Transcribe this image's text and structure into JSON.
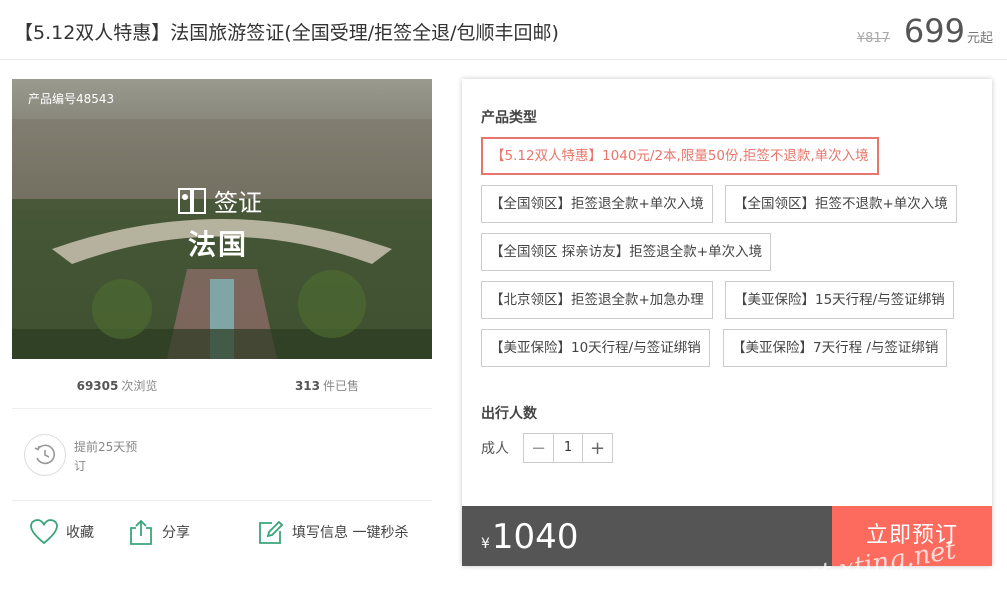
{
  "header": {
    "title": "【5.12双人特惠】法国旅游签证(全国受理/拒签全退/包顺丰回邮)",
    "old_price": "¥817",
    "price": "699",
    "price_suffix": "元起"
  },
  "hero": {
    "product_no": "产品编号48543",
    "badge_text": "签证",
    "country": "法国"
  },
  "stats": {
    "views_count": "69305",
    "views_label": "次浏览",
    "sold_count": "313",
    "sold_label": "件已售"
  },
  "advance": {
    "text": "提前25天预订"
  },
  "actions": {
    "favorite": "收藏",
    "share": "分享",
    "fill_info": "填写信息 一键秒杀"
  },
  "product_type": {
    "label": "产品类型",
    "options": [
      {
        "label": "【5.12双人特惠】1040元/2本,限量50份,拒签不退款,单次入境",
        "selected": true
      },
      {
        "label": "【全国领区】拒签退全款+单次入境",
        "selected": false
      },
      {
        "label": "【全国领区】拒签不退款+单次入境",
        "selected": false
      },
      {
        "label": "【全国领区 探亲访友】拒签退全款+单次入境",
        "selected": false
      },
      {
        "label": "【北京领区】拒签退全款+加急办理",
        "selected": false
      },
      {
        "label": "【美亚保险】15天行程/与签证绑销",
        "selected": false
      },
      {
        "label": "【美亚保险】10天行程/与签证绑销",
        "selected": false
      },
      {
        "label": "【美亚保险】7天行程 /与签证绑销",
        "selected": false
      }
    ]
  },
  "travelers": {
    "label": "出行人数",
    "adult_label": "成人",
    "quantity": "1",
    "minus": "−",
    "plus": "+"
  },
  "checkout": {
    "currency": "¥",
    "total": "1040",
    "book_label": "立即预订"
  },
  "watermark": "et.xting.net",
  "colors": {
    "accent": "#fc6b5d",
    "selected_border": "#e8766b",
    "total_bar": "#555555",
    "icon_green": "#3aa57a"
  }
}
